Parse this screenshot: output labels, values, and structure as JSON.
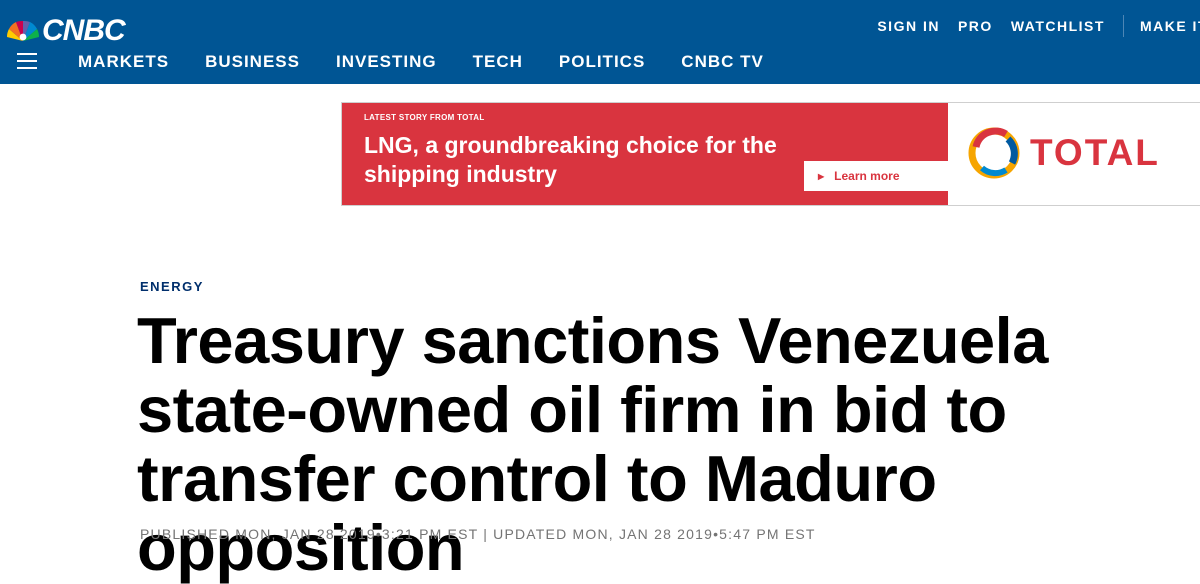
{
  "brand": {
    "logo_text": "CNBC"
  },
  "utility_nav": {
    "sign_in": "SIGN IN",
    "pro": "PRO",
    "watchlist": "WATCHLIST",
    "make_it": "MAKE IT"
  },
  "nav": {
    "items": [
      "MARKETS",
      "BUSINESS",
      "INVESTING",
      "TECH",
      "POLITICS",
      "CNBC TV"
    ]
  },
  "ad": {
    "eyebrow": "LATEST STORY FROM TOTAL",
    "headline": "LNG, a groundbreaking choice for the shipping industry",
    "cta": "Learn more",
    "advertiser_logo_text": "TOTAL"
  },
  "article": {
    "section": "ENERGY",
    "headline": "Treasury sanctions Venezuela state-owned oil firm in bid to transfer control to Maduro opposition",
    "published_line": "PUBLISHED MON, JAN 28 2019•3:21 PM EST | UPDATED MON, JAN 28 2019•5:47 PM EST"
  },
  "colors": {
    "header_bg": "#005594",
    "ad_red": "#d9343f",
    "section_label": "#002f6c",
    "meta_gray": "#747474"
  },
  "icons": [
    "peacock-icon",
    "menu-icon",
    "play-arrow-icon",
    "total-logo-icon"
  ]
}
